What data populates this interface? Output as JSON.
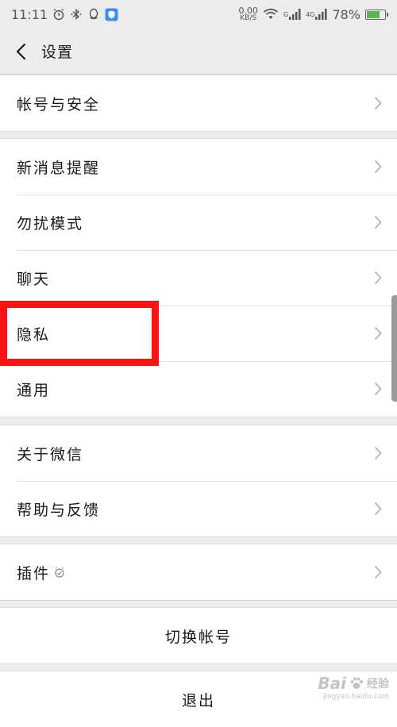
{
  "status_bar": {
    "time": "11:11",
    "net_speed_value": "0.00",
    "net_speed_unit": "KB/S",
    "signal_1_label": "G",
    "signal_2_label": "4G",
    "battery_percent": "78%",
    "battery_level": 0.78,
    "battery_color": "#5ab552",
    "icons": [
      "alarm-icon",
      "bluetooth-icon",
      "qq-icon",
      "shield-app-icon",
      "wifi-icon",
      "signal-icon",
      "battery-icon"
    ]
  },
  "header": {
    "title": "设置",
    "back_icon": "chevron-left-icon"
  },
  "groups": [
    {
      "items": [
        {
          "label": "帐号与安全"
        }
      ]
    },
    {
      "items": [
        {
          "label": "新消息提醒"
        },
        {
          "label": "勿扰模式"
        },
        {
          "label": "聊天"
        },
        {
          "label": "隐私"
        },
        {
          "label": "通用"
        }
      ]
    },
    {
      "items": [
        {
          "label": "关于微信"
        },
        {
          "label": "帮助与反馈"
        }
      ]
    },
    {
      "items": [
        {
          "label": "插件"
        }
      ]
    }
  ],
  "actions": {
    "switch_account": "切换帐号",
    "logout": "退出"
  },
  "highlight": {
    "color": "#ff1212",
    "target": "隐私"
  },
  "watermark": {
    "logo_text": "Bai",
    "logo_suffix": "经验",
    "url": "jingyan.baidu.com"
  }
}
